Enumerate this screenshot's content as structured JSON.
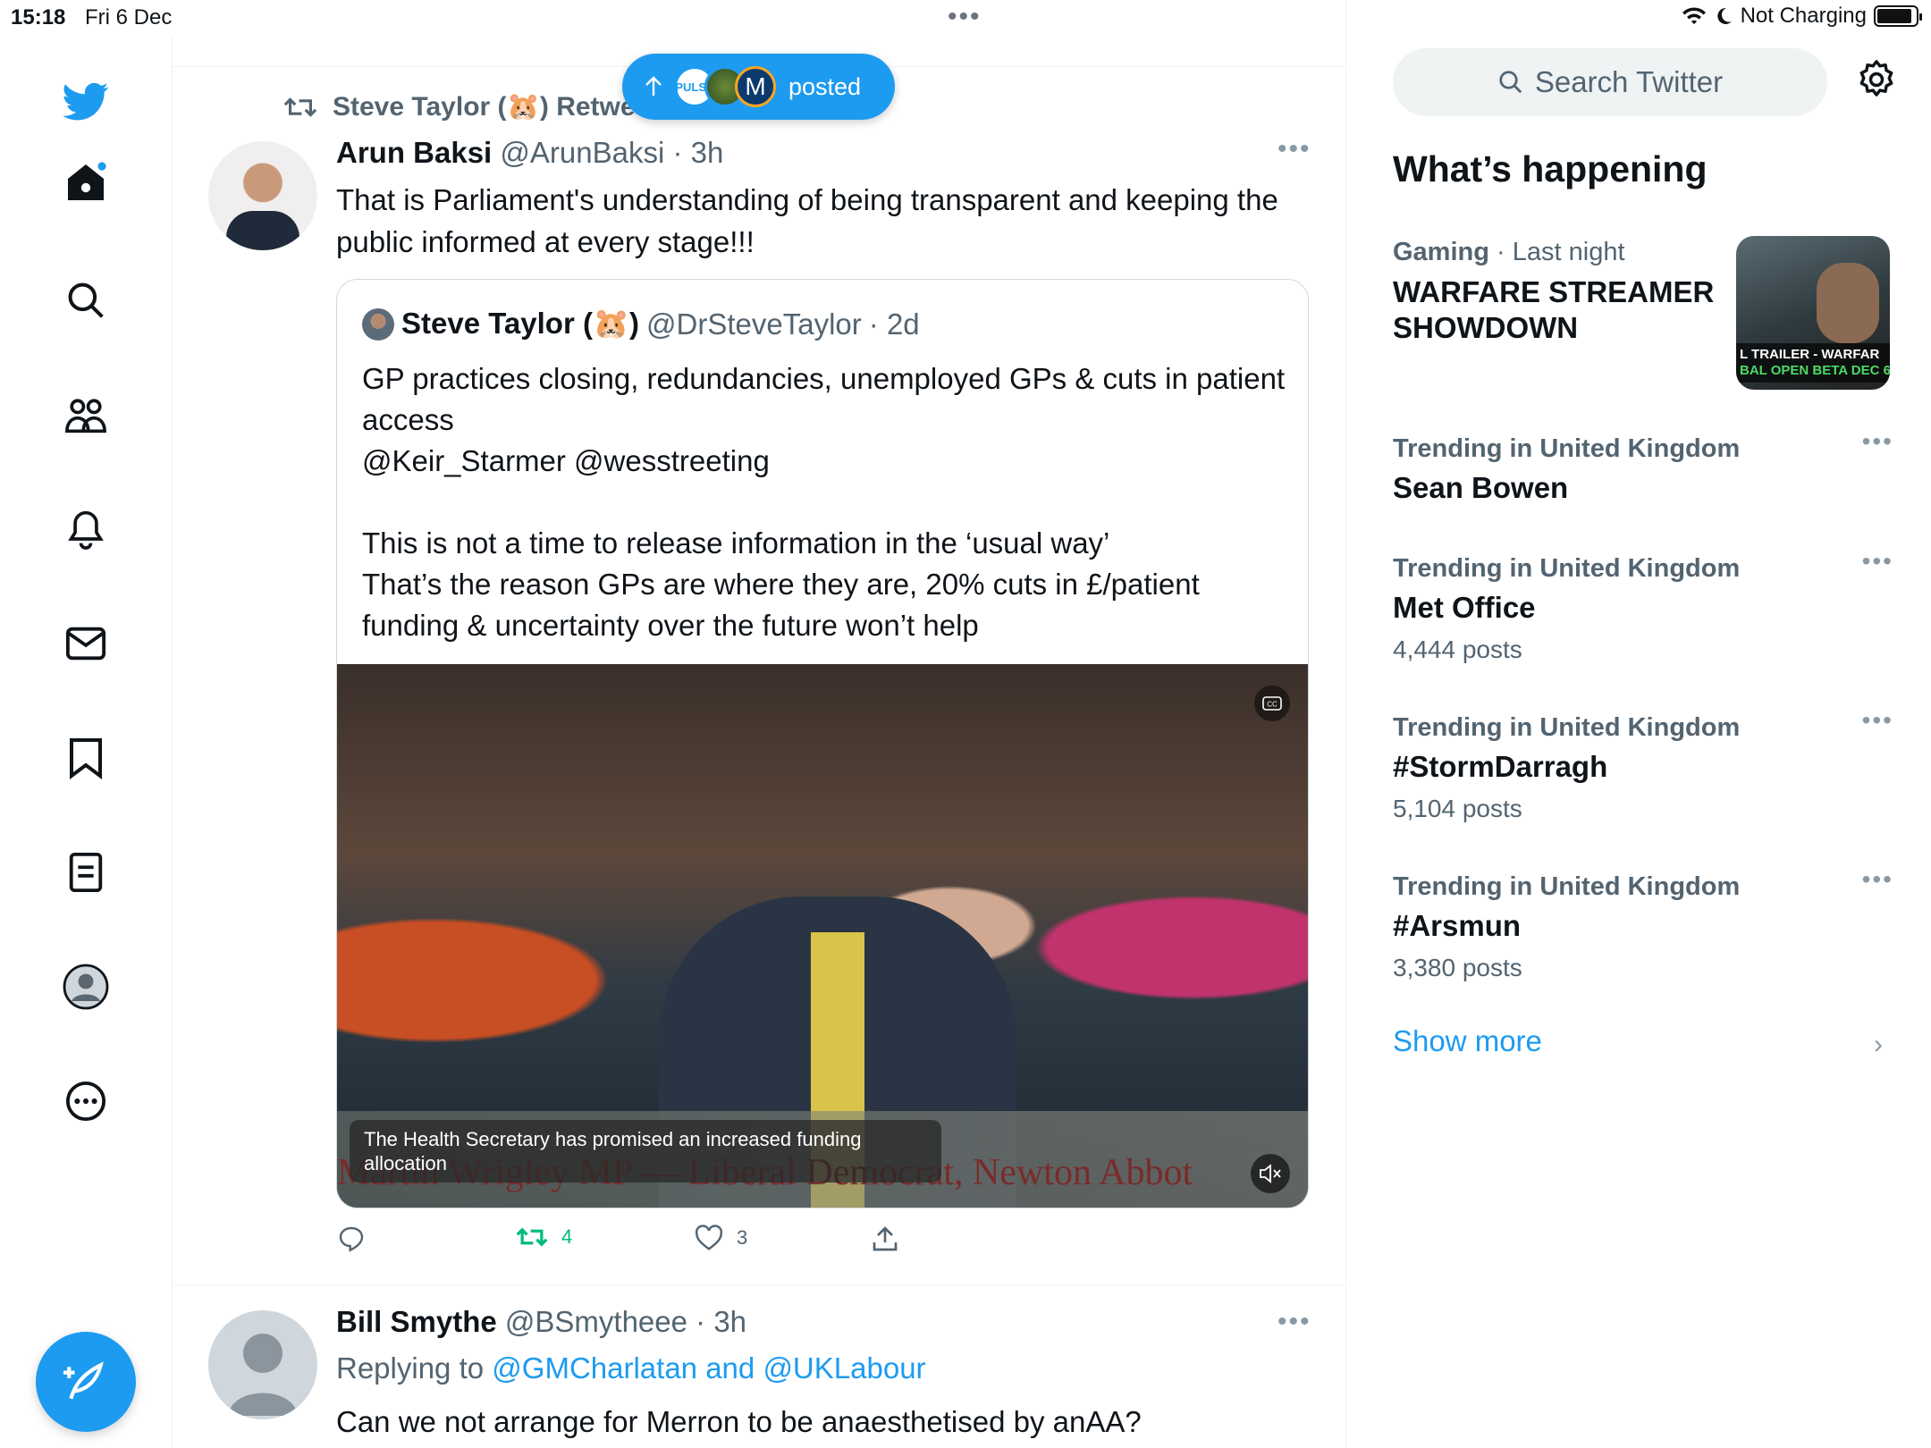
{
  "status_bar": {
    "time": "15:18",
    "date": "Fri 6 Dec",
    "charging": "Not Charging",
    "battery_level": 0.9
  },
  "nav": {
    "items": [
      "logo-icon",
      "home-icon",
      "search-icon",
      "communities-icon",
      "notifications-icon",
      "messages-icon",
      "bookmarks-icon",
      "lists-icon",
      "profile-icon",
      "more-icon"
    ],
    "compose_icon": "compose-icon"
  },
  "new_posts_pill": {
    "label": "posted",
    "avatar_label": "PULSE",
    "avatar_letter": "M"
  },
  "tweet1": {
    "retweeted_by": "Steve Taylor (🐹) Retweeted",
    "name": "Arun Baksi",
    "handle": "@ArunBaksi",
    "time": "· 3h",
    "text": "That is Parliament's understanding of being transparent and keeping the public informed at every stage!!!",
    "quote": {
      "name": "Steve Taylor (🐹)",
      "handle": "@DrSteveTaylor",
      "time": "· 2d",
      "text": "GP practices closing, redundancies, unemployed GPs & cuts in patient access\n@Keir_Starmer @wesstreeting\n\nThis is not a time to release information in the ‘usual way’\nThat’s the reason GPs are where they are, 20% cuts in £/patient funding & uncertainty over the future won’t help",
      "video": {
        "caption": "The Health Secretary has promised an increased funding allocation",
        "lower_third": "Martin Wrigley MP — Liberal Democrat, Newton Abbot"
      }
    },
    "actions": {
      "reply_count": "",
      "retweet_count": "4",
      "like_count": "3"
    }
  },
  "tweet2": {
    "name": "Bill Smythe",
    "handle": "@BSmytheee",
    "time": "· 3h",
    "replying_prefix": "Replying to",
    "replying_to_1": "@GMCharlatan",
    "replying_and": "and",
    "replying_to_2": "@UKLabour",
    "text": "Can we not arrange for Merron to be anaesthetised by anAA?"
  },
  "sidebar": {
    "search_placeholder": "Search Twitter",
    "whats_happening": "What’s happening",
    "featured": {
      "category": "Gaming",
      "time": "· Last night",
      "title": "WARFARE STREAMER SHOWDOWN",
      "image_text_1": "L TRAILER - WARFAR",
      "image_text_2": "BAL OPEN BETA DEC 6"
    },
    "trends": [
      {
        "category": "Trending in United Kingdom",
        "title": "Sean Bowen",
        "posts": ""
      },
      {
        "category": "Trending in United Kingdom",
        "title": "Met Office",
        "posts": "4,444 posts"
      },
      {
        "category": "Trending in United Kingdom",
        "title": "#StormDarragh",
        "posts": "5,104 posts"
      },
      {
        "category": "Trending in United Kingdom",
        "title": "#Arsmun",
        "posts": "3,380 posts"
      }
    ],
    "show_more": "Show more"
  },
  "colors": {
    "accent": "#1d9bf0",
    "retweet_green": "#00ba7c",
    "text_secondary": "#536471"
  }
}
